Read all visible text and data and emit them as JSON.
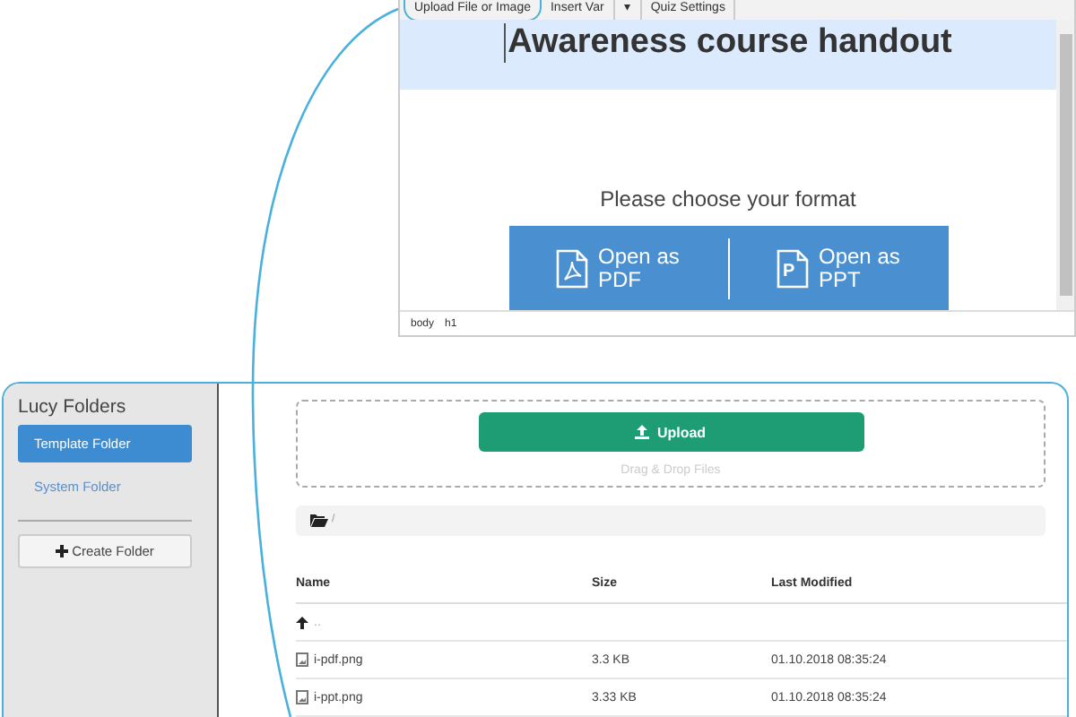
{
  "editor": {
    "toolbar": [
      {
        "label": "Upload File or Image",
        "highlighted": true
      },
      {
        "label": "Insert Var",
        "highlighted": false
      },
      {
        "label": "▾",
        "highlighted": false
      },
      {
        "label": "Quiz Settings",
        "highlighted": false
      }
    ],
    "title": "Awareness course handout",
    "prompt": "Please choose your format",
    "format_buttons": [
      {
        "kind": "pdf",
        "label": "Open as PDF"
      },
      {
        "kind": "ppt",
        "label": "Open as PPT",
        "icon_text": "P"
      }
    ],
    "status_path": [
      "body",
      "h1"
    ]
  },
  "files": {
    "sidebar": {
      "title": "Lucy Folders",
      "folders": [
        {
          "label": "Template Folder",
          "selected": true
        },
        {
          "label": "System Folder",
          "selected": false
        }
      ],
      "create_button": "Create Folder"
    },
    "upload": {
      "button": "Upload",
      "hint": "Drag & Drop Files"
    },
    "breadcrumb": "/",
    "columns": [
      "Name",
      "Size",
      "Last Modified"
    ],
    "rows": [
      {
        "kind": "parent",
        "name": "..",
        "size": "",
        "modified": ""
      },
      {
        "kind": "image",
        "name": "i-pdf.png",
        "size": "3.3 KB",
        "modified": "01.10.2018 08:35:24"
      },
      {
        "kind": "image",
        "name": "i-ppt.png",
        "size": "3.33 KB",
        "modified": "01.10.2018 08:35:24"
      }
    ]
  }
}
